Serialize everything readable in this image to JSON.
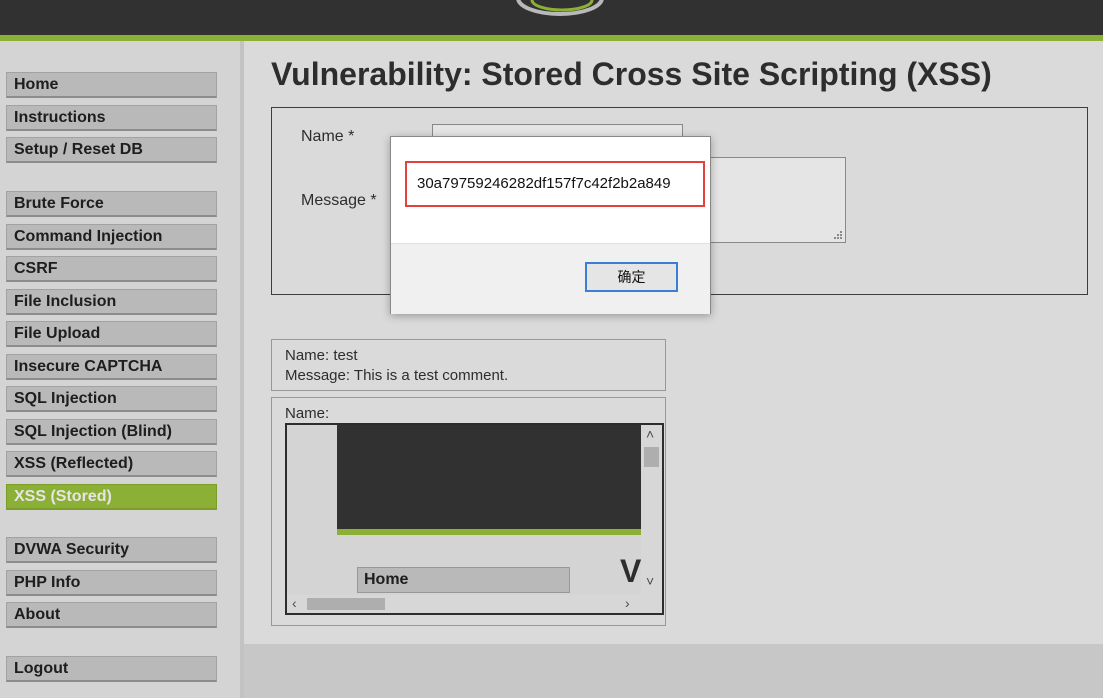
{
  "sidebar": {
    "groups": [
      [
        "Home",
        "Instructions",
        "Setup / Reset DB"
      ],
      [
        "Brute Force",
        "Command Injection",
        "CSRF",
        "File Inclusion",
        "File Upload",
        "Insecure CAPTCHA",
        "SQL Injection",
        "SQL Injection (Blind)",
        "XSS (Reflected)",
        "XSS (Stored)"
      ],
      [
        "DVWA Security",
        "PHP Info",
        "About"
      ],
      [
        "Logout"
      ]
    ],
    "active": "XSS (Stored)"
  },
  "page": {
    "title": "Vulnerability: Stored Cross Site Scripting (XSS)"
  },
  "form": {
    "name_label": "Name *",
    "message_label": "Message *",
    "name_value": "",
    "message_value": ""
  },
  "comments": [
    {
      "name_line": "Name: test",
      "message_line": "Message: This is a test comment."
    },
    {
      "name_line": "Name:"
    }
  ],
  "embedded_frame": {
    "home_label": "Home",
    "title_fragment": "V"
  },
  "dialog": {
    "message": "30a79759246282df157f7c42f2b2a849",
    "ok_label": "确定"
  },
  "colors": {
    "accent": "#9cc43c",
    "header": "#373737",
    "highlight_border": "#e34040"
  }
}
